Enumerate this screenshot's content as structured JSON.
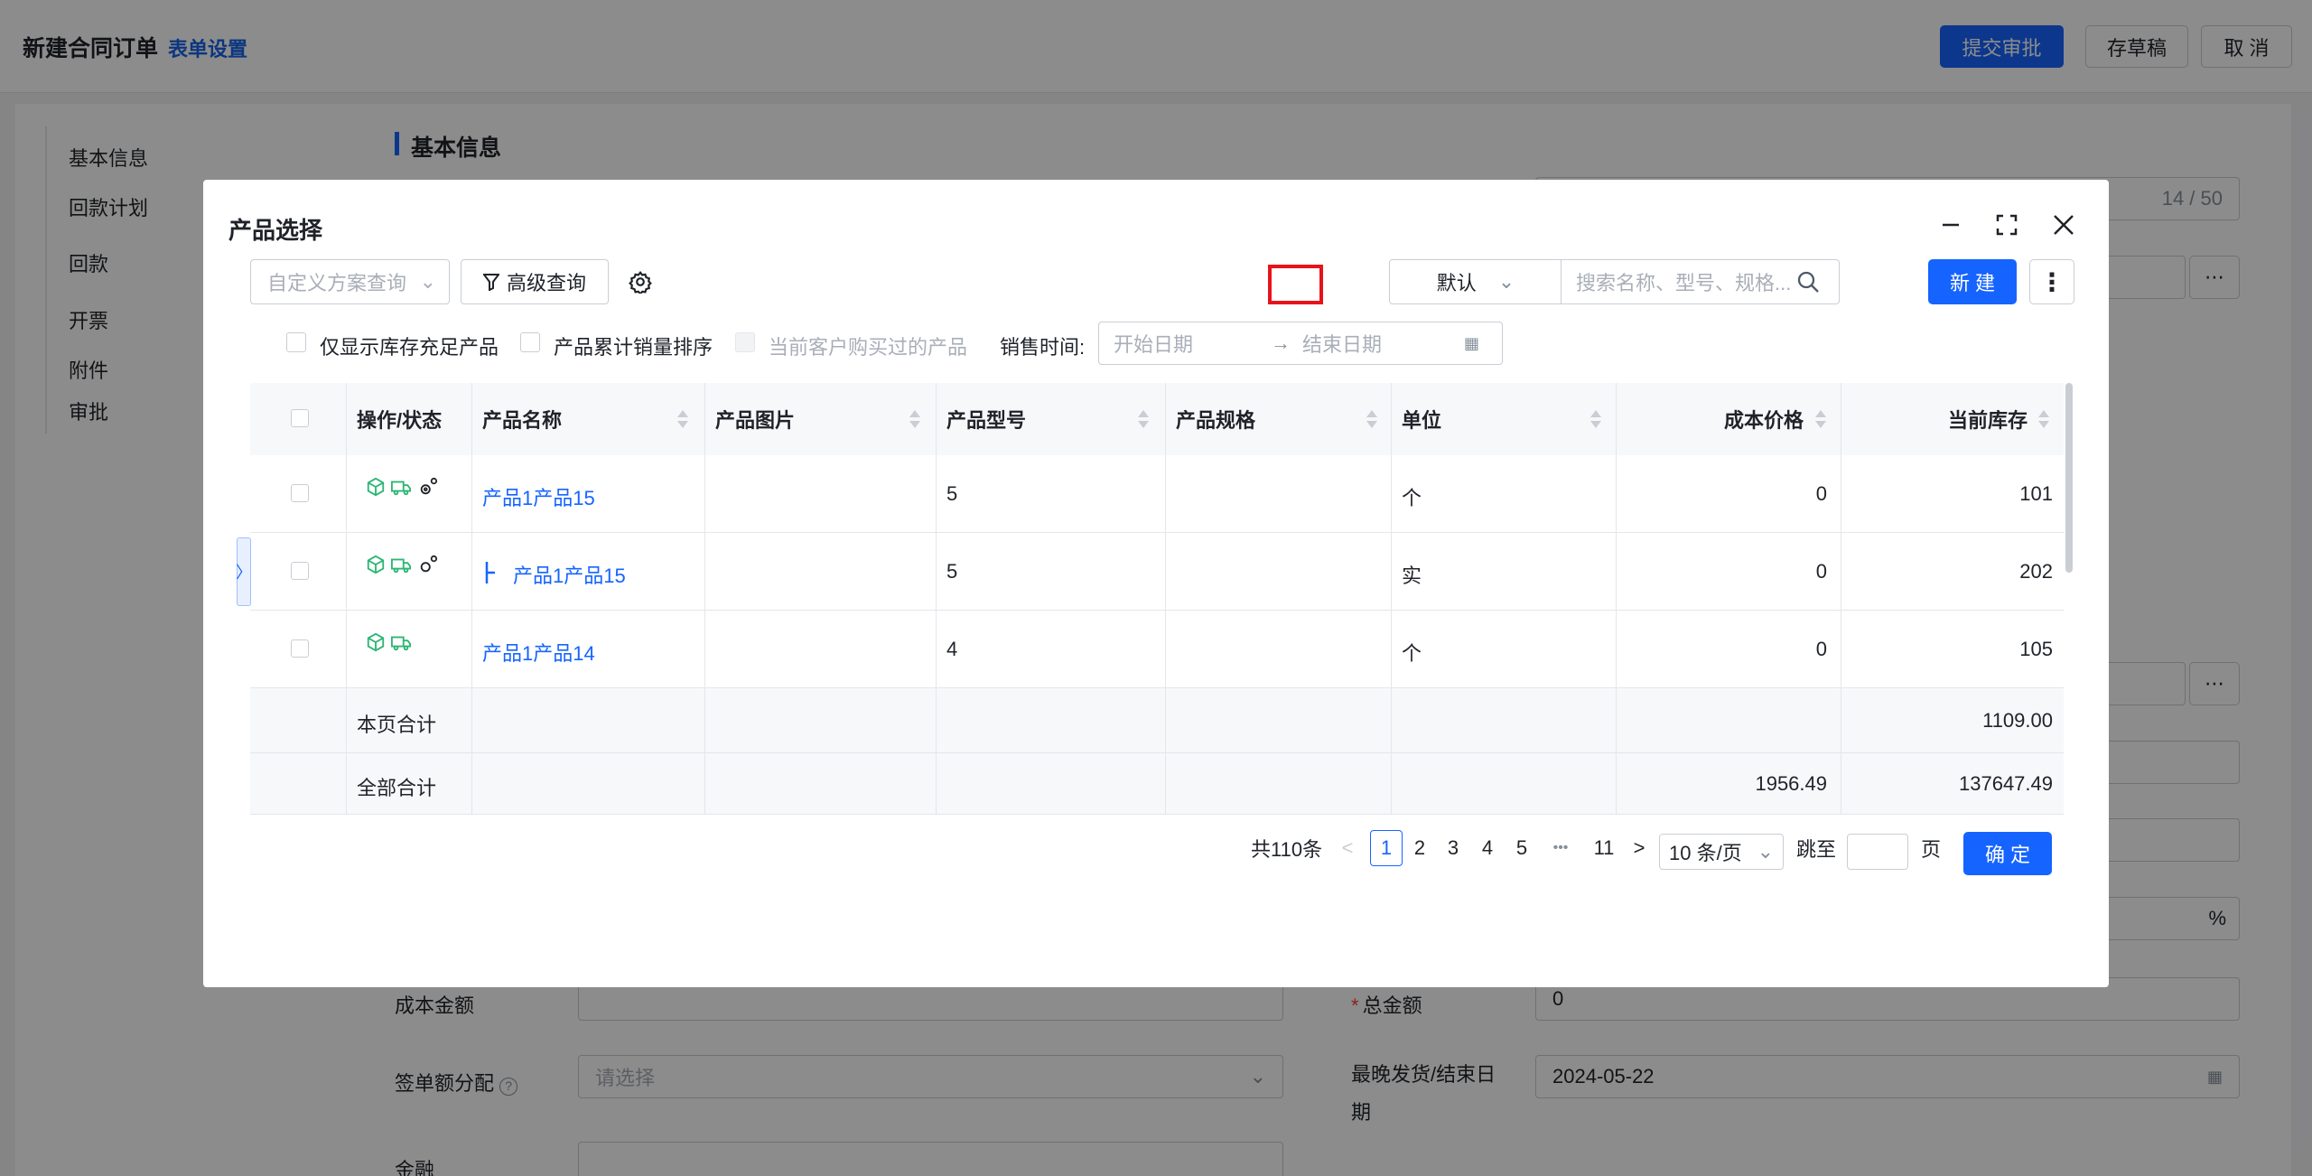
{
  "header": {
    "title": "新建合同订单",
    "form_settings": "表单设置",
    "submit": "提交审批",
    "save_draft": "存草稿",
    "cancel": "取 消"
  },
  "anchor_nav": [
    "基本信息",
    "回款计划",
    "回款",
    "开票",
    "附件",
    "审批"
  ],
  "section": {
    "title": "基本信息"
  },
  "background_form": {
    "title_counter": "14 / 50",
    "cost_amount_label": "成本金额",
    "total_amount_label": "总金额",
    "total_amount_value": "0",
    "sign_alloc_label": "签单额分配",
    "sign_alloc_placeholder": "请选择",
    "latest_ship_label_1": "最晚发货/结束日",
    "latest_ship_label_2": "期",
    "latest_ship_value": "2024-05-22",
    "percent_unit": "%",
    "bottom_label": "金融"
  },
  "modal": {
    "title": "产品选择",
    "scheme_query_placeholder": "自定义方案查询",
    "advanced_query": "高级查询",
    "sort_default": "默认",
    "search_placeholder": "搜索名称、型号、规格...",
    "new_button": "新 建",
    "filters": {
      "only_in_stock": "仅显示库存充足产品",
      "sort_by_sales": "产品累计销量排序",
      "bought_by_customer": "当前客户购买过的产品",
      "sales_time_label": "销售时间:",
      "start_date_placeholder": "开始日期",
      "end_date_placeholder": "结束日期",
      "date_arrow": "→"
    },
    "table": {
      "columns": [
        "操作/状态",
        "产品名称",
        "产品图片",
        "产品型号",
        "产品规格",
        "单位",
        "成本价格",
        "当前库存"
      ],
      "rows": [
        {
          "name": "产品1产品15",
          "model": "5",
          "spec": "",
          "unit": "个",
          "cost": "0",
          "stock": "101"
        },
        {
          "name": "产品1产品15",
          "model": "5",
          "spec": "",
          "unit": "实",
          "cost": "0",
          "stock": "202"
        },
        {
          "name": "产品1产品14",
          "model": "4",
          "spec": "",
          "unit": "个",
          "cost": "0",
          "stock": "105"
        }
      ],
      "page_total_label": "本页合计",
      "page_total_stock": "1109.00",
      "all_total_label": "全部合计",
      "all_total_cost": "1956.49",
      "all_total_stock": "137647.49"
    },
    "pagination": {
      "total": "共110条",
      "prev": "<",
      "pages": [
        "1",
        "2",
        "3",
        "4",
        "5"
      ],
      "ellipsis": "•••",
      "last_page": "11",
      "next": ">",
      "page_size": "10 条/页",
      "jump_label": "跳至",
      "page_unit": "页",
      "confirm": "确 定"
    }
  },
  "colors": {
    "primary": "#1664ff",
    "icon_green": "#2bb673",
    "highlight_red": "#e8131a"
  }
}
